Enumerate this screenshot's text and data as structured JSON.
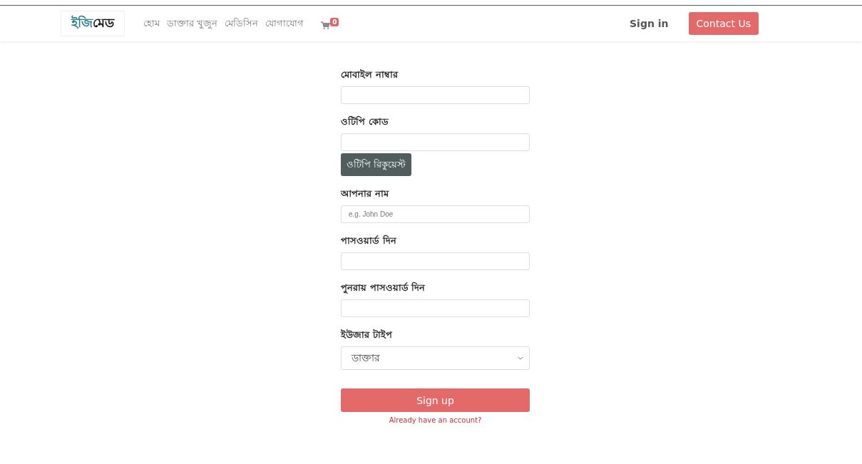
{
  "navbar": {
    "logo": {
      "part_1": "ইজি",
      "part_2": "মেড"
    },
    "links": [
      {
        "label": "হোম"
      },
      {
        "label": "ডাক্তার খুজুন"
      },
      {
        "label": "মেডিসিন"
      },
      {
        "label": "যোগাযোগ"
      }
    ],
    "cart_count": "0",
    "sign_in": "Sign in",
    "contact_button": "Contact Us"
  },
  "form": {
    "items": [
      {
        "kind": "text",
        "label": "মোবাইল নাম্বার"
      },
      {
        "kind": "text",
        "label": "ওটিপি কোড"
      },
      {
        "kind": "button",
        "label": "ওটিপি রিকুয়েস্ট"
      },
      {
        "kind": "text",
        "label": "আপনার নাম",
        "placeholder": "e.g. John Doe"
      },
      {
        "kind": "text",
        "label": "পাসওয়ার্ড দিন"
      },
      {
        "kind": "text",
        "label": "পুনরায় পাসওয়ার্ড দিন"
      },
      {
        "kind": "select",
        "label": "ইউজার টাইপ",
        "value": "ডাক্তার"
      }
    ],
    "submit": "Sign up",
    "login_link": "Already have an account?"
  }
}
